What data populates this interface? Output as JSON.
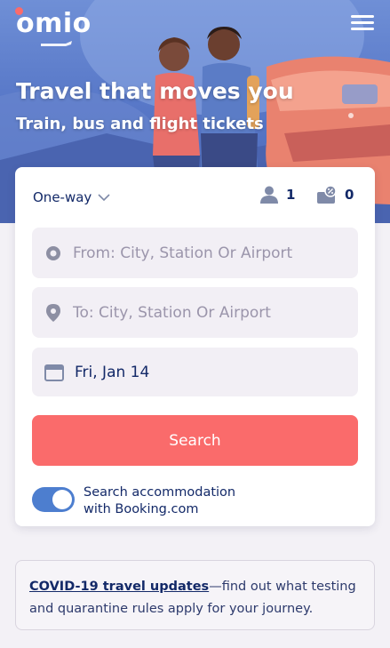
{
  "brand": {
    "logo_text": "omio",
    "accent_color": "#fa6b6b"
  },
  "header": {
    "menu_icon": "hamburger-icon"
  },
  "hero": {
    "title": "Travel that moves you",
    "subtitle": "Train, bus and flight tickets"
  },
  "search": {
    "trip_type": "One-way",
    "passengers": "1",
    "discount_cards": "0",
    "from_placeholder": "From: City, Station Or Airport",
    "to_placeholder": "To: City, Station Or Airport",
    "date_value": "Fri, Jan 14",
    "search_label": "Search",
    "accommodation_label_line1": "Search accommodation",
    "accommodation_label_line2": "with Booking.com",
    "accommodation_enabled": true
  },
  "notice": {
    "link_text": "COVID-19 travel updates",
    "text": "—find out what testing and quarantine rules apply for your journey."
  },
  "colors": {
    "primary_text": "#132968",
    "button": "#fa6b6b",
    "toggle": "#4d7ecf",
    "field_bg": "#f2eff5",
    "hero_bg": "#5878c8"
  }
}
